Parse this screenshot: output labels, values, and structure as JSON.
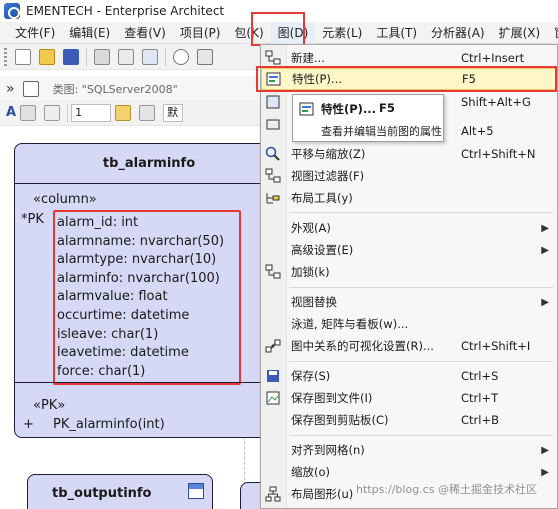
{
  "window": {
    "title": "EMENTECH - Enterprise Architect"
  },
  "menubar": {
    "items": [
      {
        "label": "文件(F)"
      },
      {
        "label": "编辑(E)"
      },
      {
        "label": "查看(V)"
      },
      {
        "label": "项目(P)"
      },
      {
        "label": "包(K)"
      },
      {
        "label": "图(D)"
      },
      {
        "label": "元素(L)"
      },
      {
        "label": "工具(T)"
      },
      {
        "label": "分析器(A)"
      },
      {
        "label": "扩展(X)"
      },
      {
        "label": "窗口("
      }
    ]
  },
  "toolbar2": {
    "type_label": "类图: \"SQLServer2008\""
  },
  "toolbar3": {
    "spin_value": "1",
    "font_combo": "默"
  },
  "entity_main": {
    "name": "tb_alarminfo",
    "column_stereotype": "«column»",
    "pk_marker": "*PK",
    "columns": [
      "alarm_id: int",
      "alarmname: nvarchar(50)",
      "alarmtype: nvarchar(10)",
      "alarminfo: nvarchar(100)",
      "alarmvalue: float",
      "occurtime: datetime",
      "isleave: char(1)",
      "leavetime: datetime",
      "force: char(1)"
    ],
    "pk_stereotype": "«PK»",
    "pk_plus": "+",
    "pk_operation": "PK_alarminfo(int)"
  },
  "entity_second": {
    "name": "tb_outputinfo"
  },
  "diagram_menu": {
    "items": [
      {
        "label": "新建...",
        "shortcut": "Ctrl+Insert",
        "icon": "new-diagram-icon"
      },
      {
        "label": "特性(P)...",
        "shortcut": "F5",
        "icon": "properties-icon"
      },
      {
        "label": "",
        "shortcut": "Shift+Alt+G",
        "icon": ""
      },
      {
        "label": "",
        "shortcut": "",
        "icon": ""
      },
      {
        "label": "",
        "shortcut": "Alt+5",
        "icon": ""
      },
      {
        "label": "平移与缩放(Z)",
        "shortcut": "Ctrl+Shift+N",
        "icon": "pan-zoom-icon"
      },
      {
        "label": "视图过滤器(F)",
        "shortcut": "",
        "icon": "view-filter-icon"
      },
      {
        "label": "布局工具(y)",
        "shortcut": "",
        "icon": "layout-tools-icon"
      },
      {
        "label": "外观(A)",
        "shortcut": "",
        "icon": ""
      },
      {
        "label": "高级设置(E)",
        "shortcut": "",
        "icon": ""
      },
      {
        "label": "加锁(k)",
        "shortcut": "",
        "icon": "lock-icon"
      },
      {
        "label": "视图替换",
        "shortcut": "",
        "icon": ""
      },
      {
        "label": "泳道, 矩阵与看板(w)...",
        "shortcut": "",
        "icon": ""
      },
      {
        "label": "图中关系的可视化设置(R)...",
        "shortcut": "Ctrl+Shift+I",
        "icon": "visual-settings-icon"
      },
      {
        "label": "保存(S)",
        "shortcut": "Ctrl+S",
        "icon": "save-icon"
      },
      {
        "label": "保存图到文件(I)",
        "shortcut": "Ctrl+T",
        "icon": "save-image-file-icon"
      },
      {
        "label": "保存图到剪贴板(C)",
        "shortcut": "Ctrl+B",
        "icon": "save-clipboard-icon"
      },
      {
        "label": "对齐到网格(n)",
        "shortcut": "",
        "icon": ""
      },
      {
        "label": "缩放(o)",
        "shortcut": "",
        "icon": ""
      },
      {
        "label": "布局图形(u)",
        "shortcut": "",
        "icon": "layout-diagram-icon"
      }
    ]
  },
  "tooltip": {
    "title": "特性(P)...",
    "shortcut": "F5",
    "description": "查看并编辑当前图的属性"
  },
  "watermark": "https://blog.cs @稀土掘金技术社区",
  "colors": {
    "entity_fill": "#d6d9f5",
    "highlight": "#fff6c8",
    "annotation_red": "#e53935"
  }
}
